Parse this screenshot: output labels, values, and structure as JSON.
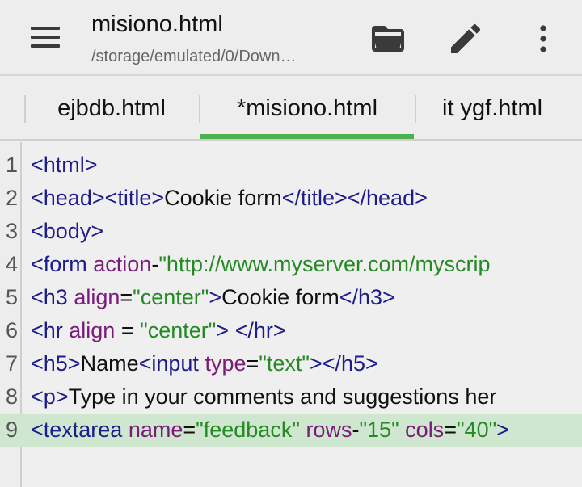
{
  "toolbar": {
    "title": "misiono.html",
    "subtitle": "/storage/emulated/0/Down…"
  },
  "icons": {
    "menu": "menu-icon",
    "open": "folder-open-icon",
    "edit": "pencil-icon",
    "more": "more-vert-icon"
  },
  "colors": {
    "accent": "#4caf50",
    "tag": "#1c1c8a",
    "attribute": "#7a1a7a",
    "string": "#258a25",
    "current_line": "#cfe6cf"
  },
  "tabs": [
    {
      "label": "ejbdb.html",
      "active": false
    },
    {
      "label": "*misiono.html",
      "active": true
    },
    {
      "label": "it ygf.html",
      "active": false
    }
  ],
  "editor": {
    "current_line": 9,
    "lines": [
      {
        "num": "1",
        "tokens": [
          {
            "t": "tag",
            "v": "<html>"
          }
        ]
      },
      {
        "num": "2",
        "tokens": [
          {
            "t": "tag",
            "v": "<head><title>"
          },
          {
            "t": "txt",
            "v": "Cookie form"
          },
          {
            "t": "tag",
            "v": "</title></head>"
          }
        ]
      },
      {
        "num": "3",
        "tokens": [
          {
            "t": "tag",
            "v": "<body>"
          }
        ]
      },
      {
        "num": "4",
        "tokens": [
          {
            "t": "tag",
            "v": "<form "
          },
          {
            "t": "attr",
            "v": "action"
          },
          {
            "t": "txt",
            "v": "-"
          },
          {
            "t": "str",
            "v": "\"http://www.myserver.com/myscrip"
          }
        ]
      },
      {
        "num": "5",
        "tokens": [
          {
            "t": "tag",
            "v": "<h3 "
          },
          {
            "t": "attr",
            "v": "align"
          },
          {
            "t": "txt",
            "v": "="
          },
          {
            "t": "str",
            "v": "\"center\""
          },
          {
            "t": "tag",
            "v": ">"
          },
          {
            "t": "txt",
            "v": "Cookie form"
          },
          {
            "t": "tag",
            "v": "</h3>"
          }
        ]
      },
      {
        "num": "6",
        "tokens": [
          {
            "t": "tag",
            "v": "<hr "
          },
          {
            "t": "attr",
            "v": "align"
          },
          {
            "t": "txt",
            "v": " = "
          },
          {
            "t": "str",
            "v": "\"center\""
          },
          {
            "t": "tag",
            "v": "> </hr>"
          }
        ]
      },
      {
        "num": "7",
        "tokens": [
          {
            "t": "tag",
            "v": "<h5>"
          },
          {
            "t": "txt",
            "v": "Name"
          },
          {
            "t": "tag",
            "v": "<input "
          },
          {
            "t": "attr",
            "v": "type"
          },
          {
            "t": "txt",
            "v": "="
          },
          {
            "t": "str",
            "v": "\"text\""
          },
          {
            "t": "tag",
            "v": "></h5>"
          }
        ]
      },
      {
        "num": "8",
        "tokens": [
          {
            "t": "tag",
            "v": "<p>"
          },
          {
            "t": "txt",
            "v": "Type in your comments and suggestions her"
          }
        ]
      },
      {
        "num": "9",
        "tokens": [
          {
            "t": "tag",
            "v": "<textarea "
          },
          {
            "t": "attr",
            "v": "name"
          },
          {
            "t": "txt",
            "v": "="
          },
          {
            "t": "str",
            "v": "\"feedback\""
          },
          {
            "t": "txt",
            "v": " "
          },
          {
            "t": "attr",
            "v": "rows"
          },
          {
            "t": "txt",
            "v": "-"
          },
          {
            "t": "str",
            "v": "\"15\""
          },
          {
            "t": "txt",
            "v": " "
          },
          {
            "t": "attr",
            "v": "cols"
          },
          {
            "t": "txt",
            "v": "="
          },
          {
            "t": "str",
            "v": "\"40\""
          },
          {
            "t": "tag",
            "v": ">"
          }
        ]
      }
    ]
  }
}
